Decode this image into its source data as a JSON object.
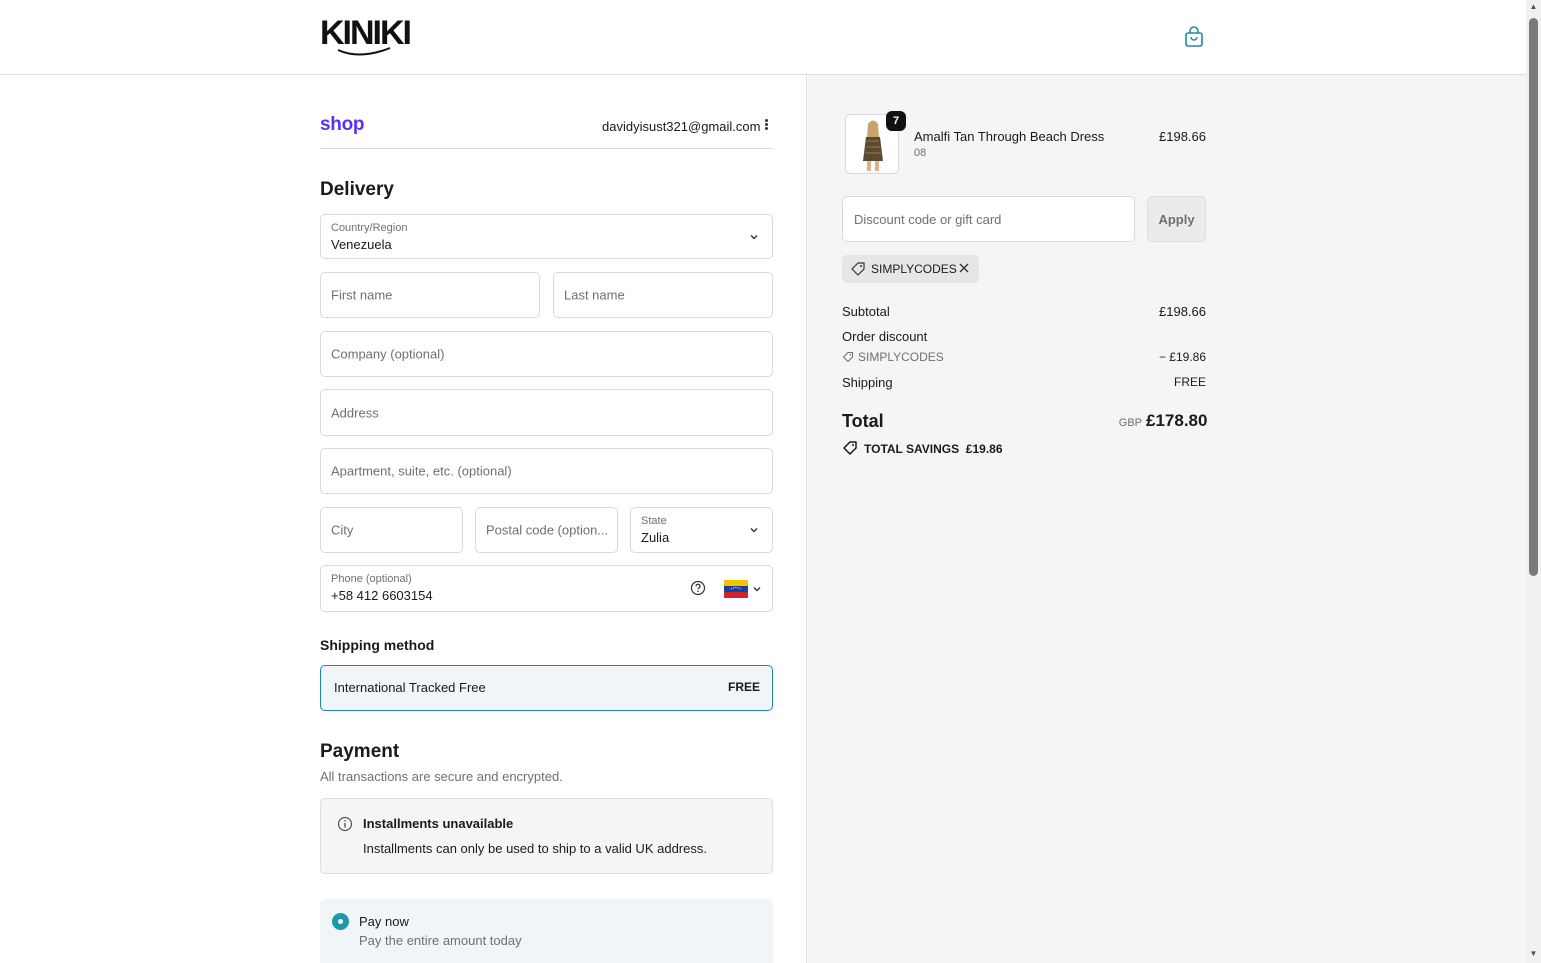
{
  "brand": {
    "logo_text": "KINIKI"
  },
  "account": {
    "shop_logo": "shop",
    "email": "davidyisust321@gmail.com"
  },
  "delivery": {
    "title": "Delivery",
    "country": {
      "label": "Country/Region",
      "value": "Venezuela"
    },
    "first_name": {
      "placeholder": "First name"
    },
    "last_name": {
      "placeholder": "Last name"
    },
    "company": {
      "placeholder": "Company (optional)"
    },
    "address": {
      "placeholder": "Address"
    },
    "apartment": {
      "placeholder": "Apartment, suite, etc. (optional)"
    },
    "city": {
      "placeholder": "City"
    },
    "postal": {
      "placeholder": "Postal code (option..."
    },
    "state": {
      "label": "State",
      "value": "Zulia"
    },
    "phone": {
      "label": "Phone (optional)",
      "value": "+58 412 6603154"
    }
  },
  "shipping_method": {
    "title": "Shipping method",
    "option": {
      "name": "International Tracked Free",
      "price": "FREE"
    }
  },
  "payment": {
    "title": "Payment",
    "subtitle": "All transactions are secure and encrypted.",
    "installments": {
      "title": "Installments unavailable",
      "text": "Installments can only be used to ship to a valid UK address."
    },
    "pay_now": {
      "title": "Pay now",
      "subtitle": "Pay the entire amount today"
    }
  },
  "summary": {
    "item": {
      "quantity": "7",
      "name": "Amalfi Tan Through Beach Dress",
      "variant": "08",
      "price": "£198.66"
    },
    "discount_input": {
      "placeholder": "Discount code or gift card"
    },
    "apply_label": "Apply",
    "applied_code": "SIMPLYCODES",
    "subtotal": {
      "label": "Subtotal",
      "value": "£198.66"
    },
    "order_discount": {
      "label": "Order discount",
      "code": "SIMPLYCODES",
      "value": "− £19.86"
    },
    "shipping": {
      "label": "Shipping",
      "value": "FREE"
    },
    "total": {
      "label": "Total",
      "currency": "GBP",
      "value": "£178.80"
    },
    "savings": {
      "label": "TOTAL SAVINGS",
      "value": "£19.86"
    }
  },
  "colors": {
    "accent": "#1e99a8",
    "shop_purple": "#5a31f4",
    "panel_bg": "#f5f5f5"
  }
}
